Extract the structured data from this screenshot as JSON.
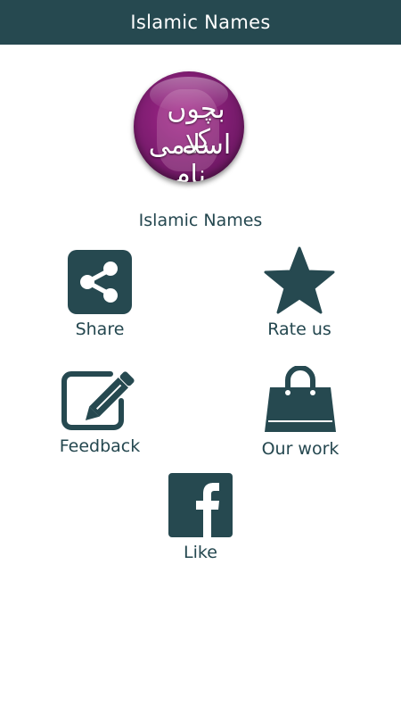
{
  "app_bar": {
    "title": "Islamic Names"
  },
  "logo": {
    "line1": "بچوں کے",
    "line2": "اسلامی نام"
  },
  "app_name": "Islamic Names",
  "menu": {
    "share": {
      "label": "Share",
      "icon": "share-icon"
    },
    "rate": {
      "label": "Rate us",
      "icon": "star-icon"
    },
    "feedback": {
      "label": "Feedback",
      "icon": "edit-icon"
    },
    "work": {
      "label": "Our work",
      "icon": "shopping-bag-icon"
    },
    "like": {
      "label": "Like",
      "icon": "facebook-icon"
    }
  },
  "colors": {
    "primary": "#264950",
    "background": "#ffffff",
    "logo": "#8a2079"
  }
}
